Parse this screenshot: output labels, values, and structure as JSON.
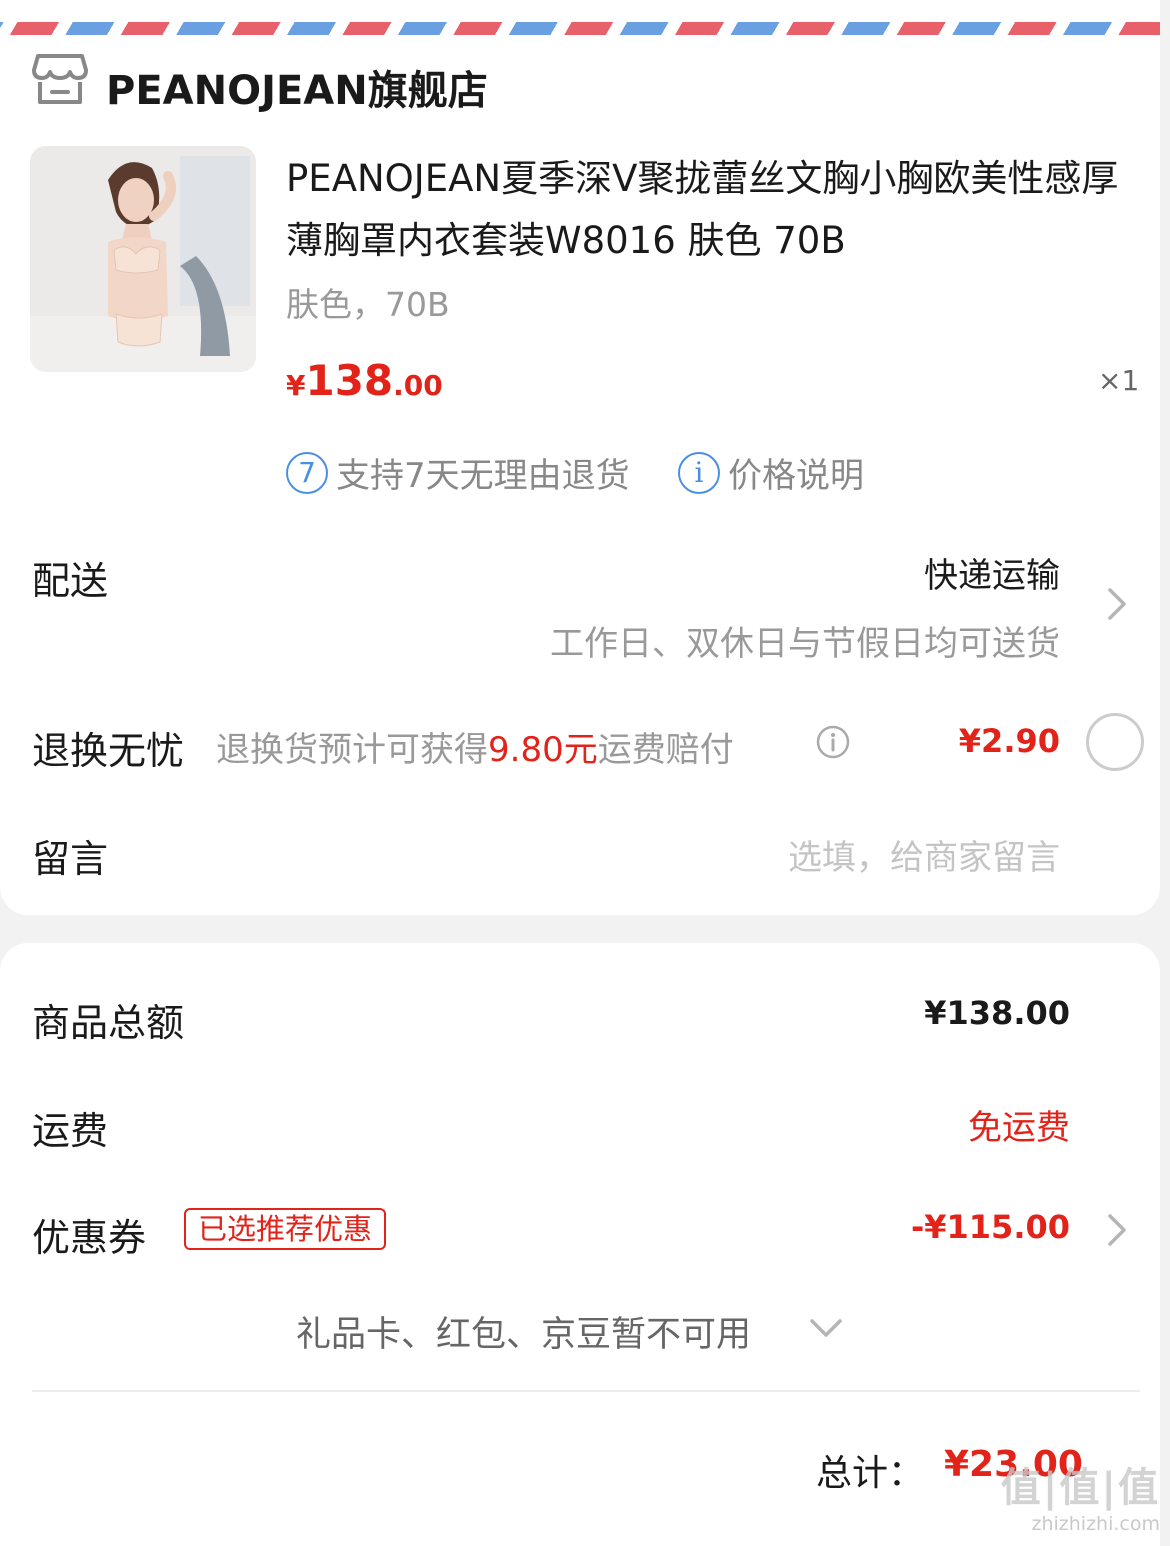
{
  "shop": {
    "name": "PEANOJEAN旗舰店",
    "icon": "store-icon"
  },
  "product": {
    "title": "PEANOJEAN夏季深V聚拢蕾丝文胸小胸欧美性感厚薄胸罩内衣套装W8016 肤色 70B",
    "sku": "肤色，70B",
    "price_currency": "¥",
    "price_int": "138",
    "price_dec": ".00",
    "quantity": "×1"
  },
  "services": [
    {
      "icon_text": "7",
      "label": "支持7天无理由退货"
    },
    {
      "icon_text": "i",
      "label": "价格说明"
    }
  ],
  "delivery": {
    "label": "配送",
    "method": "快递运输",
    "note": "工作日、双休日与节假日均可送货"
  },
  "return_insurance": {
    "label": "退换无忧",
    "desc_prefix": "退换货预计可获得",
    "desc_amount": "9.80元",
    "desc_suffix": "运费赔付",
    "price": "¥2.90"
  },
  "message": {
    "label": "留言",
    "placeholder": "选填，给商家留言"
  },
  "summary": {
    "goods_total_label": "商品总额",
    "goods_total_value": "¥138.00",
    "shipping_label": "运费",
    "shipping_value": "免运费",
    "coupon_label": "优惠券",
    "coupon_tag": "已选推荐优惠",
    "coupon_value": "-¥115.00",
    "unavailable": "礼品卡、红包、京豆暂不可用",
    "total_label": "总计：",
    "total_value": "¥23.00"
  },
  "watermark": {
    "big": "值|值|值",
    "small": "zhizhizhi.com"
  },
  "colors": {
    "accent_red": "#e2231a",
    "service_blue": "#4a90e2",
    "airmail_red": "#e8616a",
    "airmail_blue": "#6aa0e2"
  }
}
